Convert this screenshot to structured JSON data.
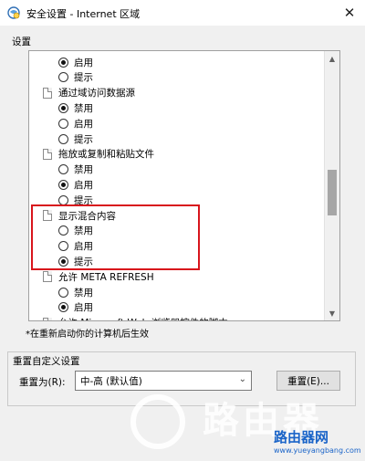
{
  "window": {
    "title": "安全设置 - Internet 区域",
    "close_glyph": "✕"
  },
  "settings_group": {
    "label": "设置"
  },
  "tree": [
    {
      "type": "option",
      "label": "启用",
      "checked": true
    },
    {
      "type": "option",
      "label": "提示",
      "checked": false
    },
    {
      "type": "setting",
      "label": "通过域访问数据源"
    },
    {
      "type": "option",
      "label": "禁用",
      "checked": true
    },
    {
      "type": "option",
      "label": "启用",
      "checked": false
    },
    {
      "type": "option",
      "label": "提示",
      "checked": false
    },
    {
      "type": "setting",
      "label": "拖放或复制和粘贴文件"
    },
    {
      "type": "option",
      "label": "禁用",
      "checked": false
    },
    {
      "type": "option",
      "label": "启用",
      "checked": true
    },
    {
      "type": "option",
      "label": "提示",
      "checked": false
    },
    {
      "type": "setting",
      "label": "显示混合内容"
    },
    {
      "type": "option",
      "label": "禁用",
      "checked": false
    },
    {
      "type": "option",
      "label": "启用",
      "checked": false
    },
    {
      "type": "option",
      "label": "提示",
      "checked": true
    },
    {
      "type": "setting",
      "label": "允许 META REFRESH"
    },
    {
      "type": "option",
      "label": "禁用",
      "checked": false
    },
    {
      "type": "option",
      "label": "启用",
      "checked": true
    },
    {
      "type": "setting",
      "label": "允许 Microsoft Web 浏览器控件的脚本"
    }
  ],
  "note": "*在重新启动你的计算机后生效",
  "custom": {
    "group_label": "重置自定义设置",
    "reset_to_label": "重置为(R):",
    "select_value": "中-高 (默认值)",
    "reset_button": "重置(E)..."
  },
  "watermark": {
    "text": "路由器",
    "site_label": "路由器网",
    "site_url": "www.yueyangbang.com"
  },
  "colors": {
    "highlight": "#d8151c",
    "site": "#1a64c8"
  }
}
